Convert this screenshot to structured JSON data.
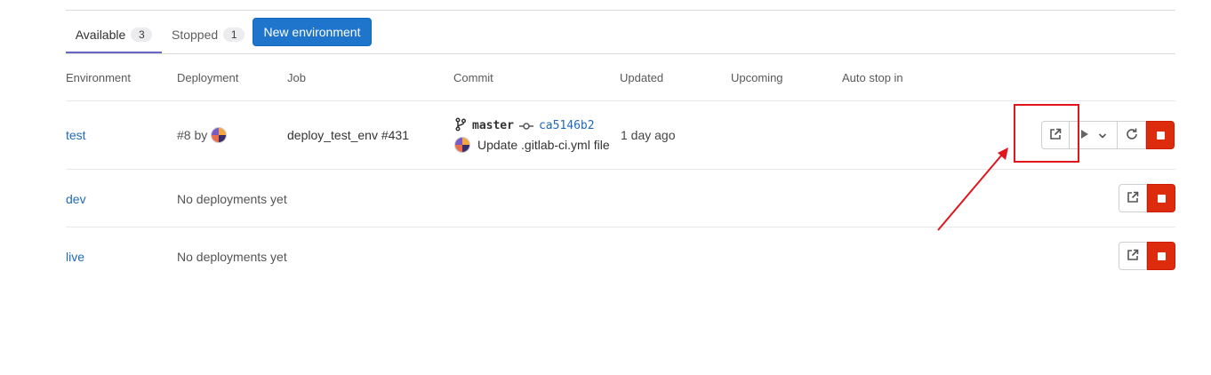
{
  "tabs": [
    {
      "label": "Available",
      "count": "3",
      "active": true
    },
    {
      "label": "Stopped",
      "count": "1",
      "active": false
    }
  ],
  "new_environment_label": "New environment",
  "columns": [
    "Environment",
    "Deployment",
    "Job",
    "Commit",
    "Updated",
    "Upcoming",
    "Auto stop in"
  ],
  "environments": [
    {
      "name": "test",
      "deployment": "#8 by",
      "job": "deploy_test_env #431",
      "commit": {
        "branch": "master",
        "sha": "ca5146b2",
        "title": "Update .gitlab-ci.yml file"
      },
      "updated": "1 day ago",
      "actions": [
        "external-link",
        "deploy-dropdown",
        "rollback",
        "stop"
      ]
    },
    {
      "name": "dev",
      "deployment": "No deployments yet",
      "actions": [
        "external-link",
        "stop"
      ]
    },
    {
      "name": "live",
      "deployment": "No deployments yet",
      "actions": [
        "external-link",
        "stop"
      ]
    }
  ],
  "icons": {
    "external_link": "external-link-icon",
    "play": "play-icon",
    "chevron": "chevron-down-icon",
    "retry": "retry-icon",
    "stop": "stop-icon",
    "branch": "branch-icon",
    "commit": "commit-icon"
  },
  "colors": {
    "primary": "#1f75cb",
    "link": "#1f6bb8",
    "danger": "#dd2b0e",
    "annotation": "#e0161c",
    "tab_underline": "#6666c4"
  }
}
